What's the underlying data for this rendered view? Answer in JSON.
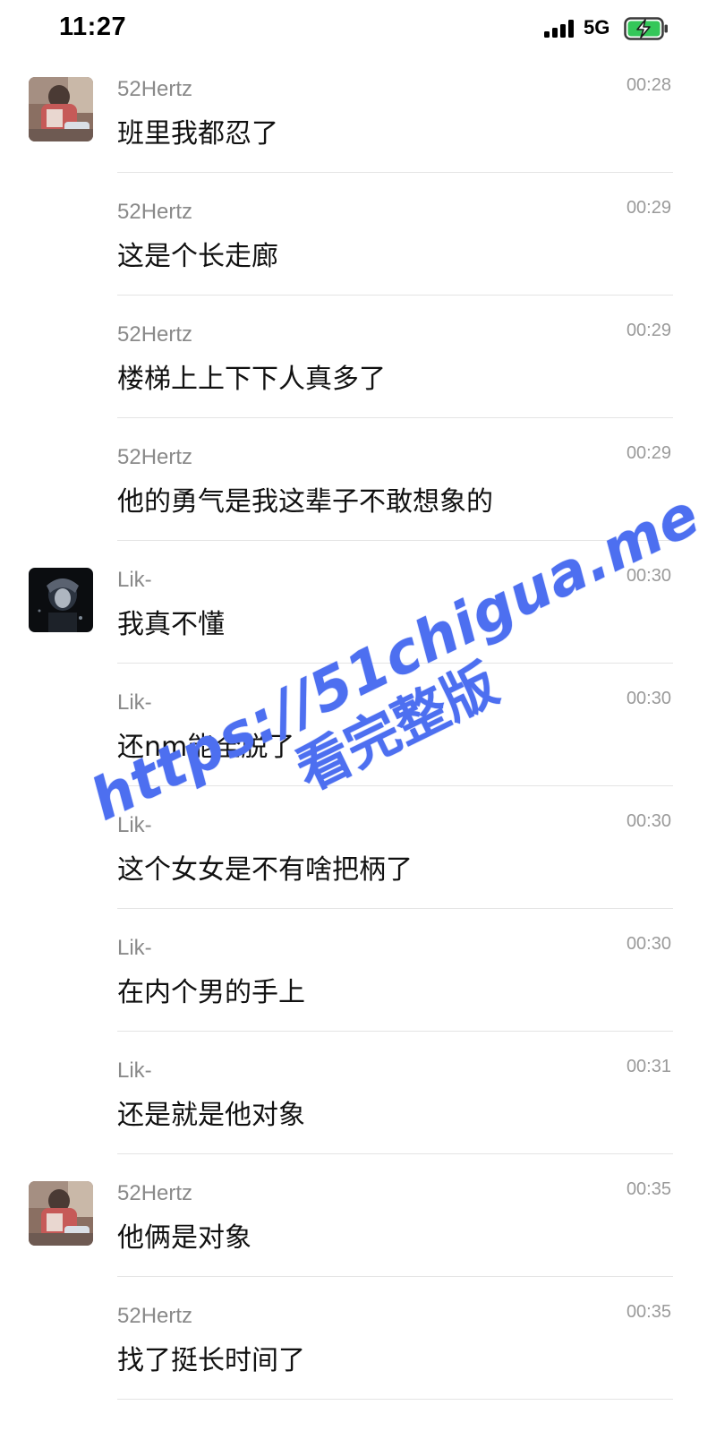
{
  "status_bar": {
    "time": "11:27",
    "network": "5G",
    "icons": [
      "signal-icon",
      "battery-charging-icon"
    ]
  },
  "messages": [
    {
      "sender": "52Hertz",
      "time": "00:28",
      "text": "班里我都忍了",
      "avatar": "avatar-52hertz"
    },
    {
      "sender": "52Hertz",
      "time": "00:29",
      "text": "这是个长走廊",
      "avatar": null
    },
    {
      "sender": "52Hertz",
      "time": "00:29",
      "text": "楼梯上上下下人真多了",
      "avatar": null
    },
    {
      "sender": "52Hertz",
      "time": "00:29",
      "text": "他的勇气是我这辈子不敢想象的",
      "avatar": null
    },
    {
      "sender": "Lik-",
      "time": "00:30",
      "text": "我真不懂",
      "avatar": "avatar-lik"
    },
    {
      "sender": "Lik-",
      "time": "00:30",
      "text": "还nm能全脱了",
      "avatar": null
    },
    {
      "sender": "Lik-",
      "time": "00:30",
      "text": "这个女女是不有啥把柄了",
      "avatar": null
    },
    {
      "sender": "Lik-",
      "time": "00:30",
      "text": "在内个男的手上",
      "avatar": null
    },
    {
      "sender": "Lik-",
      "time": "00:31",
      "text": "还是就是他对象",
      "avatar": null
    },
    {
      "sender": "52Hertz",
      "time": "00:35",
      "text": "他俩是对象",
      "avatar": "avatar-52hertz"
    },
    {
      "sender": "52Hertz",
      "time": "00:35",
      "text": "找了挺长时间了",
      "avatar": null
    }
  ],
  "watermark": {
    "line1": "https://51chigua.me",
    "line2": "看完整版",
    "color": "#4d6ff0"
  },
  "colors": {
    "sender": "#8a8a8a",
    "timestamp": "#9a9a9a",
    "divider": "#e4e4e4"
  }
}
